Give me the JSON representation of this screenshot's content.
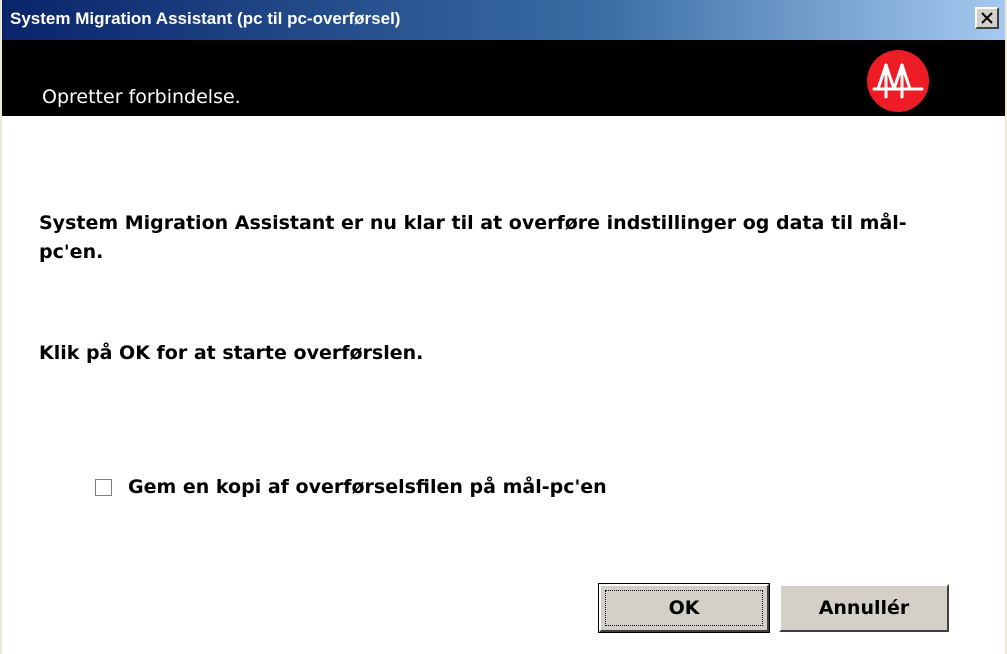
{
  "window": {
    "title": "System Migration Assistant (pc til pc-overførsel)",
    "close_glyph": "✕"
  },
  "header": {
    "heading": "Opretter forbindelse."
  },
  "content": {
    "message_ready": "System Migration Assistant er nu klar til at overføre indstillinger og data til mål-pc'en.",
    "message_instruction": "Klik på OK for at starte overførslen."
  },
  "options": {
    "save_copy_label": "Gem en kopi af overførselsfilen på mål-pc'en",
    "save_copy_checked": false
  },
  "buttons": {
    "ok_label": "OK",
    "cancel_label": "Annullér"
  },
  "colors": {
    "title_bar": "#0a246a",
    "header_band": "#000000",
    "logo_circle": "#ee1c24",
    "button_face": "#d4d0c8"
  },
  "icons": {
    "logo": "migration-assistant-logo-icon",
    "close": "close-icon",
    "checkbox": "checkbox-unchecked-icon"
  }
}
